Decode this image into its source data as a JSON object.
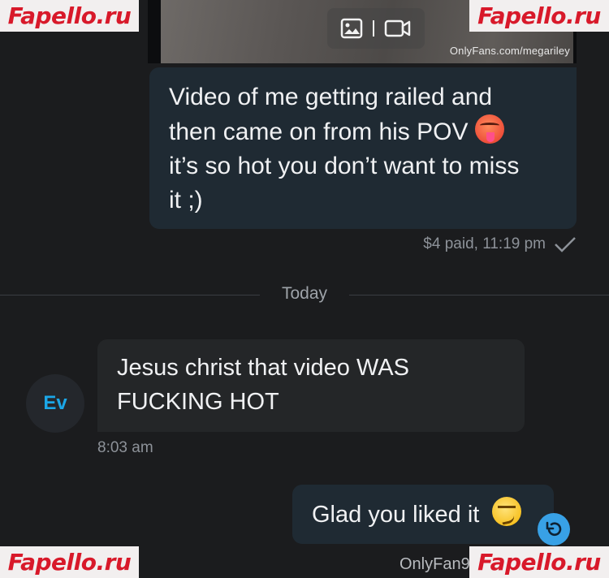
{
  "watermark": {
    "text": "Fapello.ru"
  },
  "media": {
    "credit": "OnlyFans.com/megariley",
    "icons": [
      "image-icon",
      "video-icon"
    ]
  },
  "messages": {
    "outgoing_1": {
      "line_1": "Video of me getting railed and",
      "line_2_a": "then came on from his POV",
      "emoji_1": "hot-face-emoji",
      "line_3": "it’s so hot you don’t want to miss",
      "line_4": "it ;)",
      "status": "$4 paid, 11:19 pm"
    },
    "incoming_1": {
      "avatar_initials": "Ev",
      "line_1": "Jesus christ that video WAS",
      "line_2": "FUCKING HOT",
      "time": "8:03 am"
    },
    "outgoing_2": {
      "text": "Glad you liked it",
      "emoji": "smirking-face-emoji"
    }
  },
  "separator": {
    "label": "Today"
  },
  "footer": {
    "credit_fragment": "OnlyFan",
    "time_fragment": "9:"
  },
  "colors": {
    "background": "#1b1c1e",
    "outgoing_bubble": "#1f2a33",
    "incoming_bubble": "#242628",
    "accent": "#38a1e6",
    "watermark_red": "#d8192a"
  }
}
